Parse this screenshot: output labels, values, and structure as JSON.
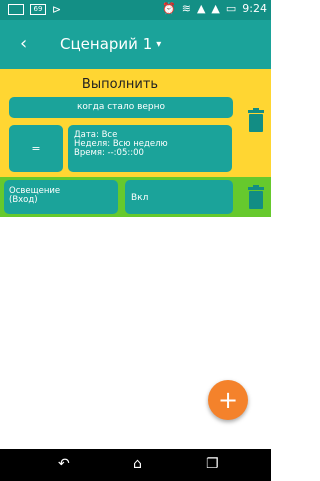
{
  "status": {
    "badge": "69",
    "time": "9:24"
  },
  "appbar": {
    "back_glyph": "‹",
    "title": "Сценарий 1",
    "dropdown_glyph": "▾"
  },
  "block": {
    "header": "Выполнить",
    "condition_label": "когда стало верно",
    "operator": "=",
    "schedule": {
      "date": "Дата: Все",
      "week": "Неделя: Всю неделю",
      "time": "Время: --:05::00"
    }
  },
  "action": {
    "device_line1": "Освещение",
    "device_line2": "(Вход)",
    "value": "Вкл"
  },
  "fab": {
    "glyph": "+"
  },
  "nav": {
    "back_glyph": "↶",
    "home_glyph": "⌂",
    "recents_glyph": "❐"
  },
  "colors": {
    "primary": "#1ba39a",
    "status_bar": "#138f85",
    "block_yellow": "#ffd632",
    "block_green": "#66c92d",
    "fab_orange": "#f4822b"
  },
  "icons": [
    "wifi-icon",
    "signal-icon",
    "battery-icon",
    "alarm-icon",
    "trash-icon",
    "add-icon"
  ]
}
